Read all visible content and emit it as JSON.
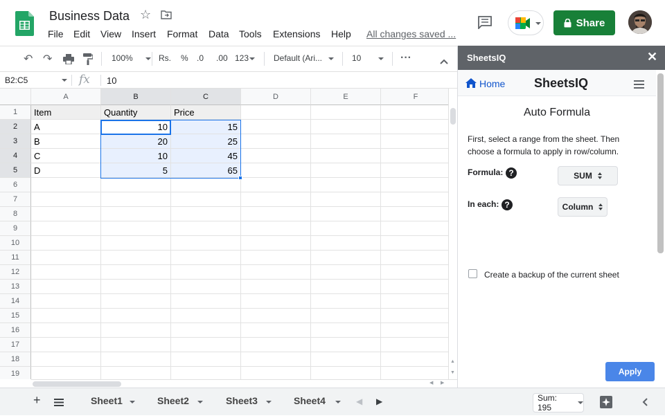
{
  "doc": {
    "title": "Business Data",
    "saved_status": "All changes saved ..."
  },
  "menu": [
    "File",
    "Edit",
    "View",
    "Insert",
    "Format",
    "Data",
    "Tools",
    "Extensions",
    "Help"
  ],
  "share_label": "Share",
  "toolbar": {
    "zoom": "100%",
    "currency": "Rs.",
    "percent": "%",
    "dec_less": ".0",
    "dec_more": ".00",
    "num_format": "123",
    "font": "Default (Ari...",
    "font_size": "10",
    "more": "···"
  },
  "formula_bar": {
    "name_box": "B2:C5",
    "fx": "fx",
    "value": "10"
  },
  "columns": [
    "A",
    "B",
    "C",
    "D",
    "E",
    "F"
  ],
  "rows": [
    "1",
    "2",
    "3",
    "4",
    "5",
    "6",
    "7",
    "8",
    "9",
    "10",
    "11",
    "12",
    "13",
    "14",
    "15",
    "16",
    "17",
    "18",
    "19"
  ],
  "cells": {
    "headers": [
      "Item",
      "Quantity",
      "Price"
    ],
    "data": [
      [
        "A",
        "10",
        "15"
      ],
      [
        "B",
        "20",
        "25"
      ],
      [
        "C",
        "10",
        "45"
      ],
      [
        "D",
        "5",
        "65"
      ]
    ]
  },
  "sheets": [
    "Sheet1",
    "Sheet2",
    "Sheet3",
    "Sheet4"
  ],
  "status": {
    "sum": "Sum: 195"
  },
  "sidebar": {
    "header_title": "SheetsIQ",
    "home_label": "Home",
    "brand": "SheetsIQ",
    "heading": "Auto Formula",
    "description": "First, select a range from the sheet. Then choose a formula to apply in row/column.",
    "formula_label": "Formula:",
    "formula_value": "SUM",
    "each_label": "In each:",
    "each_value": "Column",
    "help_glyph": "?",
    "backup_label": "Create a backup of the current sheet",
    "apply_label": "Apply"
  }
}
